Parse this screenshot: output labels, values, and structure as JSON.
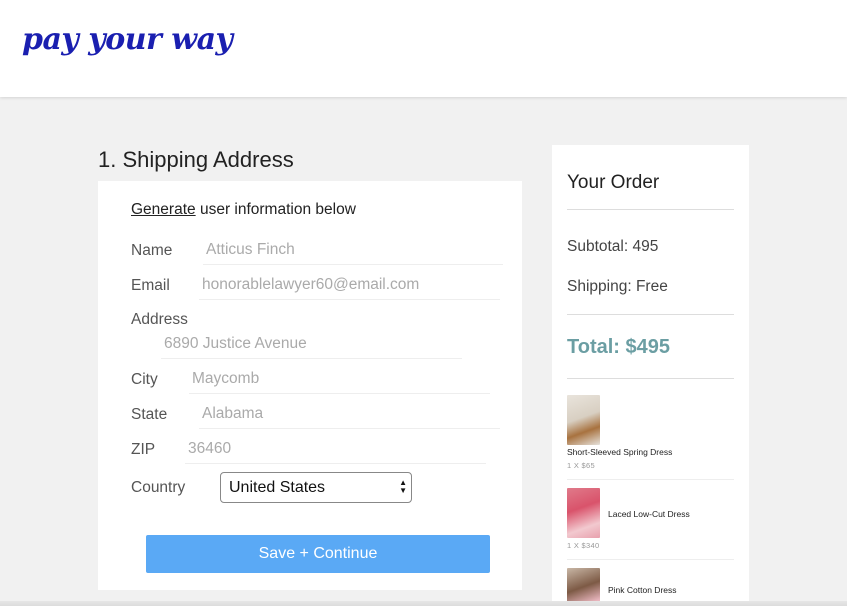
{
  "header": {
    "logo_text": "pay your way"
  },
  "shipping": {
    "section_title": "1. Shipping Address",
    "generate_link": "Generate",
    "generate_rest": " user information below",
    "fields": {
      "name": {
        "label": "Name",
        "placeholder": "Atticus Finch"
      },
      "email": {
        "label": "Email",
        "placeholder": "honorablelawyer60@email.com"
      },
      "address": {
        "label": "Address",
        "placeholder": "6890 Justice Avenue"
      },
      "city": {
        "label": "City",
        "placeholder": "Maycomb"
      },
      "state": {
        "label": "State",
        "placeholder": "Alabama"
      },
      "zip": {
        "label": "ZIP",
        "placeholder": "36460"
      },
      "country": {
        "label": "Country",
        "selected": "United States"
      }
    },
    "save_button": "Save + Continue"
  },
  "order": {
    "title": "Your Order",
    "subtotal": "Subtotal: 495",
    "shipping": "Shipping: Free",
    "total": "Total: $495",
    "items": [
      {
        "name": "Short-Sleeved Spring Dress",
        "qty": "1 X $65"
      },
      {
        "name": "Laced Low-Cut Dress",
        "qty": "1 X $340"
      },
      {
        "name": "Pink Cotton Dress",
        "qty": ""
      }
    ]
  },
  "colors": {
    "logo": "#1a1fb0",
    "button": "#5aa9f5",
    "total": "#6b9ea3",
    "background": "#f1f1f1"
  }
}
